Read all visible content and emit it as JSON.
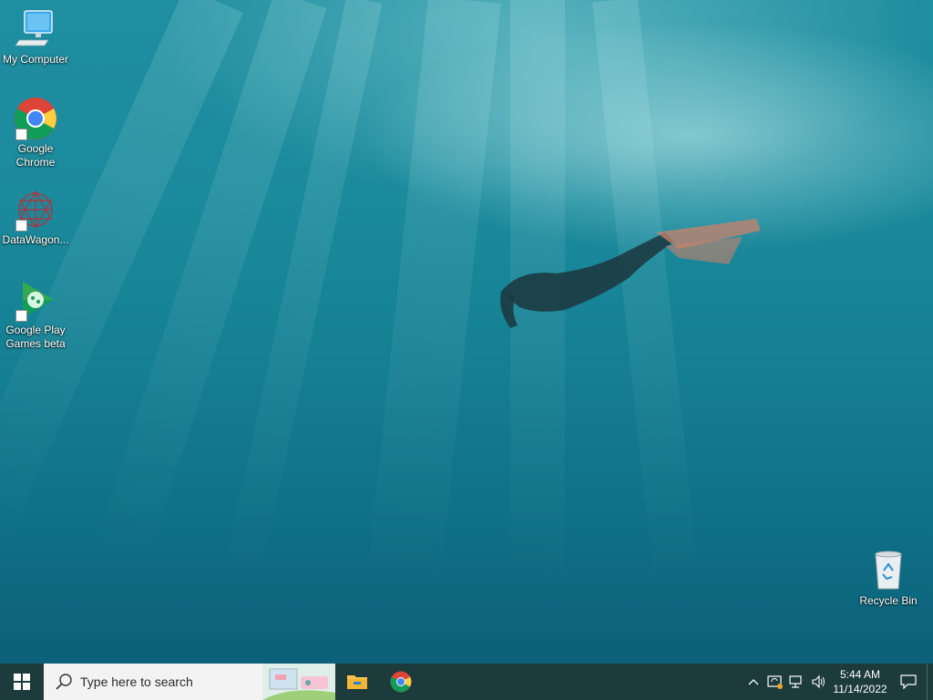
{
  "desktop": {
    "icons": [
      {
        "label": "My Computer",
        "icon": "computer-icon"
      },
      {
        "label": "Google Chrome",
        "icon": "chrome-icon"
      },
      {
        "label": "DataWagon...",
        "icon": "datawagon-icon"
      },
      {
        "label": "Google Play Games beta",
        "icon": "google-play-games-icon"
      },
      {
        "label": "Recycle Bin",
        "icon": "recycle-bin-icon"
      }
    ]
  },
  "taskbar": {
    "start_icon": "windows-logo-icon",
    "search": {
      "placeholder": "Type here to search"
    },
    "pinned": [
      {
        "icon": "file-explorer-icon"
      },
      {
        "icon": "chrome-icon"
      }
    ],
    "tray": {
      "icons": [
        "chevron-up-icon",
        "update-icon",
        "network-icon",
        "volume-icon"
      ],
      "time": "5:44 AM",
      "date": "11/14/2022",
      "notification_icon": "notification-icon"
    }
  },
  "colors": {
    "taskbar": "#1d3a3c",
    "search_bg": "#f3f3f3",
    "water_top": "#1f8ea0",
    "water_bottom": "#0c6079"
  }
}
